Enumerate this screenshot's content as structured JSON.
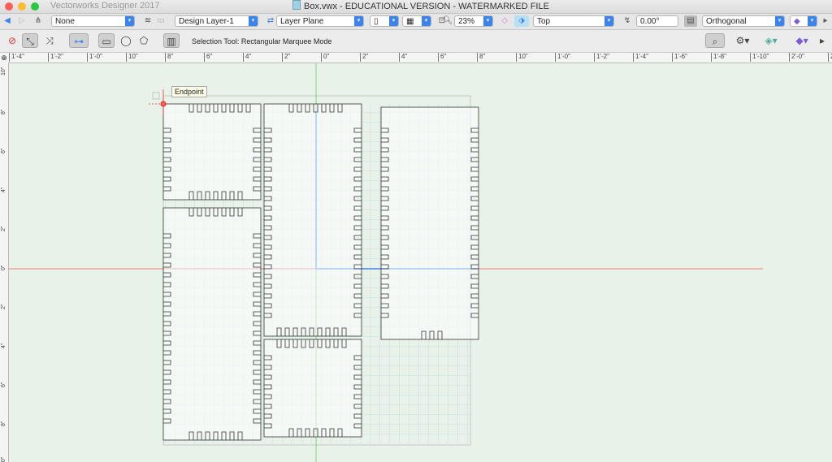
{
  "window": {
    "app_title": "Vectorworks Designer 2017",
    "doc_title": "Box.vwx - EDUCATIONAL VERSION - WATERMARKED FILE"
  },
  "view_bar": {
    "class_select": "None",
    "layer_select": "Design Layer-1",
    "plane_select": "Layer Plane",
    "zoom_select": "23%",
    "view_select": "Top",
    "rotation_value": "0.00°",
    "projection_select": "Orthogonal"
  },
  "tool_bar": {
    "mode_text": "Selection Tool: Rectangular Marquee Mode"
  },
  "snap_tooltip": "Endpoint",
  "ruler_h": [
    "1'-4\"",
    "1'-2\"",
    "1'-0\"",
    "10\"",
    "8\"",
    "6\"",
    "4\"",
    "2\"",
    "0\"",
    "2\"",
    "4\"",
    "6\"",
    "8\"",
    "10\"",
    "1'-0\"",
    "1'-2\"",
    "1'-4\"",
    "1'-6\"",
    "1'-8\"",
    "1'-10\"",
    "2'-0\"",
    "2'-2"
  ],
  "ruler_v": [
    "10\"",
    "8\"",
    "6\"",
    "4\"",
    "2\"",
    "0\"",
    "2\"",
    "4\"",
    "6\"",
    "8\"",
    "10\""
  ],
  "colors": {
    "canvas": "#e9f2e8",
    "grid": "#a9cde4",
    "origin_x": "#e55",
    "origin_y": "#6c6",
    "axis_blue": "#6aa0e8",
    "accent": "#3b84f0"
  },
  "icons": [
    "back-arrow-icon",
    "forward-arrow-icon",
    "navigation-icon",
    "layers-icon",
    "class-icon",
    "page-icon",
    "sheet-icon",
    "zoom-icon",
    "view-cube-icon",
    "rotate-plane-icon",
    "rendering-icon",
    "forbidden-icon",
    "select-icon",
    "multi-select-icon",
    "marquee-rect-icon",
    "lasso-icon",
    "polygon-select-icon",
    "settings-gear-icon",
    "snap-icon",
    "layers-visibility-icon",
    "zoom-fit-icon"
  ]
}
